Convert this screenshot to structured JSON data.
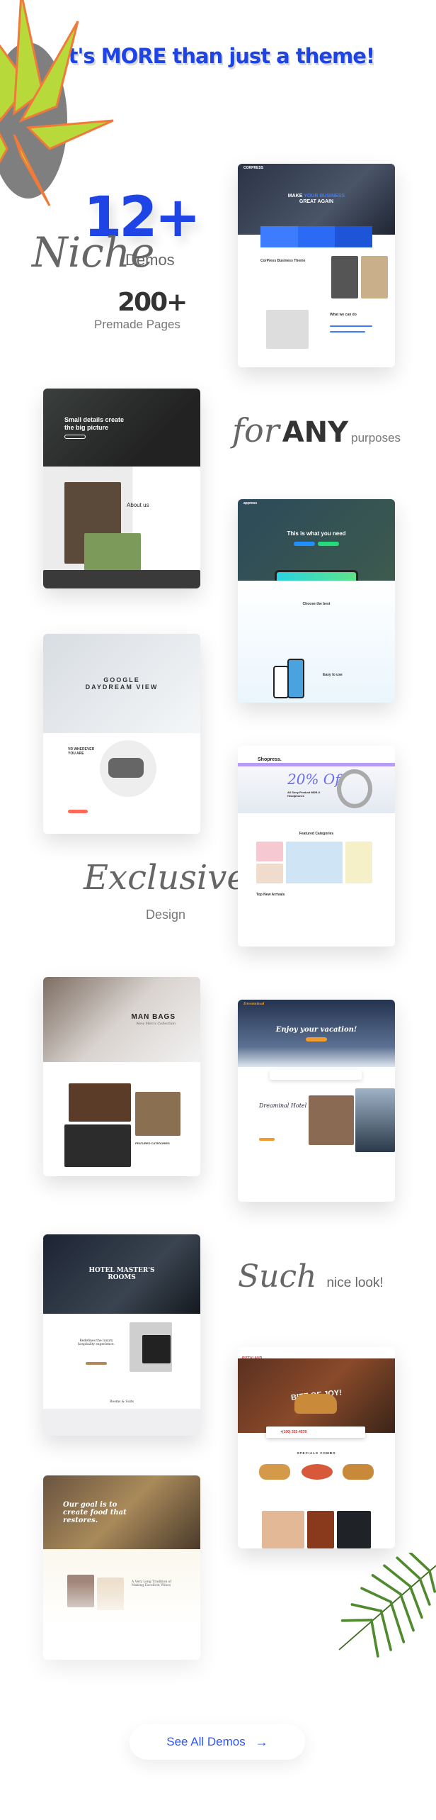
{
  "headline": "It's MORE than just a theme!",
  "stats": {
    "demos_count": "12+",
    "demos_script": "Niche",
    "demos_label": "Demos",
    "pages_count": "200+",
    "pages_label": "Premade Pages"
  },
  "taglines": {
    "for_script": "for",
    "any": "ANY",
    "purposes": "purposes",
    "exclusive_script": "Exclusive",
    "design": "Design",
    "such_script": "Such",
    "nice_look": "nice look!"
  },
  "demos": [
    {
      "name": "business",
      "logo": "CORPRESS",
      "hero_a": "MAKE ",
      "hero_b": "YOUR BUSINESS",
      "hero_c": "GREAT AGAIN",
      "section1": "CorPress Business Theme",
      "section2": "What we can do"
    },
    {
      "name": "agency",
      "hero": "Small details create the big picture",
      "section": "About us"
    },
    {
      "name": "app",
      "logo": "appress",
      "hero": "This is what you need",
      "section1": "Choose the best",
      "section2": "Easy to use"
    },
    {
      "name": "vr",
      "hero": "GOOGLE DAYDREAM VIEW",
      "section": "VR WHEREVER YOU ARE"
    },
    {
      "name": "shop",
      "logo": "Shopress.",
      "promo": "20% Off",
      "product": "All Sony Product MDR-X Headphones",
      "section1": "Featured Categories",
      "section2": "Top New Arrivals"
    },
    {
      "name": "fashion",
      "hero": "MAN BAGS",
      "sub": "New Men's Collection",
      "section": "FEATURED CATEGORIES"
    },
    {
      "name": "resort",
      "logo": "Dreaminal",
      "hero": "Enjoy your vacation!",
      "section": "Dreaminal Hotel"
    },
    {
      "name": "hotel",
      "hero": "HOTEL MASTER'S ROOMS",
      "section1": "Redefines the luxury hospitality experience.",
      "section2": "Rooms & Suits"
    },
    {
      "name": "food",
      "logo": "PIZZALAND",
      "hero": "BITE OF JOY!",
      "phone": "+(100) 333-4578",
      "section": "SPECIALS COMBO"
    },
    {
      "name": "restaurant",
      "hero": "Our goal is to create food that restores.",
      "section": "A Very Long Tradition of Making Excellent Wines"
    }
  ],
  "cta": {
    "label": "See All Demos",
    "icon": "arrow-right-icon"
  },
  "colors": {
    "brand_blue": "#1e44e6",
    "script_gray": "#666666",
    "dark_text": "#333333"
  }
}
